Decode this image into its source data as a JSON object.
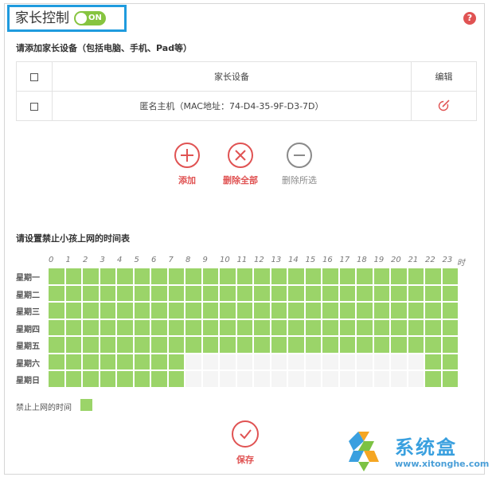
{
  "header": {
    "title": "家长控制",
    "toggle_label": "ON",
    "help_glyph": "?"
  },
  "devices_section": {
    "title": "请添加家长设备（包括电脑、手机、Pad等）",
    "columns": [
      "家长设备",
      "编辑"
    ],
    "rows": [
      {
        "name": "匿名主机（MAC地址：74-D4-35-9F-D3-7D）"
      }
    ]
  },
  "actions": {
    "add": "添加",
    "delete_all": "删除全部",
    "delete_selected": "删除所选"
  },
  "schedule": {
    "title": "请设置禁止小孩上网的时间表",
    "hours": [
      "0",
      "1",
      "2",
      "3",
      "4",
      "5",
      "6",
      "7",
      "8",
      "9",
      "10",
      "11",
      "12",
      "13",
      "14",
      "15",
      "16",
      "17",
      "18",
      "19",
      "20",
      "21",
      "22",
      "23"
    ],
    "hour_unit": "时",
    "days": [
      "星期一",
      "星期二",
      "星期三",
      "星期四",
      "星期五",
      "星期六",
      "星期日"
    ],
    "blocked": [
      [
        1,
        1,
        1,
        1,
        1,
        1,
        1,
        1,
        1,
        1,
        1,
        1,
        1,
        1,
        1,
        1,
        1,
        1,
        1,
        1,
        1,
        1,
        1,
        1
      ],
      [
        1,
        1,
        1,
        1,
        1,
        1,
        1,
        1,
        1,
        1,
        1,
        1,
        1,
        1,
        1,
        1,
        1,
        1,
        1,
        1,
        1,
        1,
        1,
        1
      ],
      [
        1,
        1,
        1,
        1,
        1,
        1,
        1,
        1,
        1,
        1,
        1,
        1,
        1,
        1,
        1,
        1,
        1,
        1,
        1,
        1,
        1,
        1,
        1,
        1
      ],
      [
        1,
        1,
        1,
        1,
        1,
        1,
        1,
        1,
        1,
        1,
        1,
        1,
        1,
        1,
        1,
        1,
        1,
        1,
        1,
        1,
        1,
        1,
        1,
        1
      ],
      [
        1,
        1,
        1,
        1,
        1,
        1,
        1,
        1,
        1,
        1,
        1,
        1,
        1,
        1,
        1,
        1,
        1,
        1,
        1,
        1,
        1,
        1,
        1,
        1
      ],
      [
        1,
        1,
        1,
        1,
        1,
        1,
        1,
        1,
        0,
        0,
        0,
        0,
        0,
        0,
        0,
        0,
        0,
        0,
        0,
        0,
        0,
        0,
        1,
        1
      ],
      [
        1,
        1,
        1,
        1,
        1,
        1,
        1,
        1,
        0,
        0,
        0,
        0,
        0,
        0,
        0,
        0,
        0,
        0,
        0,
        0,
        0,
        0,
        1,
        1
      ]
    ],
    "legend_label": "禁止上网的时间"
  },
  "save": {
    "label": "保存"
  },
  "watermark": {
    "text": "系统盒",
    "url": "www.xitonghe.com"
  },
  "colors": {
    "accent_blue": "#1f9bde",
    "blocked_green": "#9bd469",
    "toggle_green": "#86c440",
    "danger_red": "#e05353",
    "disabled_gray": "#8a8a8a"
  }
}
